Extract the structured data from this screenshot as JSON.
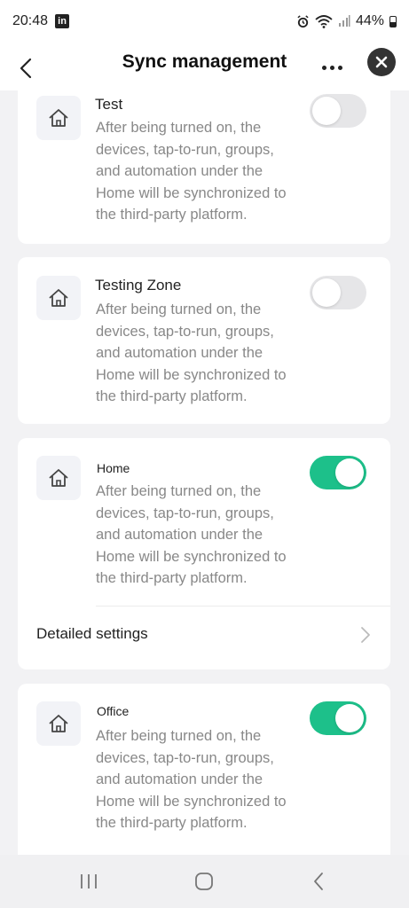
{
  "status_bar": {
    "time": "20:48",
    "app_badge": "in",
    "battery": "44%"
  },
  "header": {
    "title": "Sync management"
  },
  "homes": [
    {
      "name": "Test",
      "description": "After being turned on, the devices, tap-to-run, groups, and automation under the Home will be synchronized to the third-party platform.",
      "enabled": false
    },
    {
      "name": "Testing Zone",
      "description": "After being turned on, the devices, tap-to-run, groups, and automation under the Home will be synchronized to the third-party platform.",
      "enabled": false
    },
    {
      "name": "Home",
      "description": "After being turned on, the devices, tap-to-run, groups, and automation under the Home will be synchronized to the third-party platform.",
      "enabled": true,
      "detail_label": "Detailed settings"
    },
    {
      "name": "Office",
      "description": "After being turned on, the devices, tap-to-run, groups, and automation under the Home will be synchronized to the third-party platform.",
      "enabled": true
    }
  ],
  "colors": {
    "toggle_on": "#1dc08a",
    "toggle_off": "#e6e6e8",
    "background": "#f2f2f4"
  },
  "icons": [
    "linkedin-icon",
    "alarm-icon",
    "wifi-icon",
    "signal-icon",
    "battery-icon",
    "back-icon",
    "more-icon",
    "close-icon",
    "home-icon",
    "chevron-right-icon",
    "recent-apps-icon",
    "home-nav-icon",
    "back-nav-icon"
  ]
}
